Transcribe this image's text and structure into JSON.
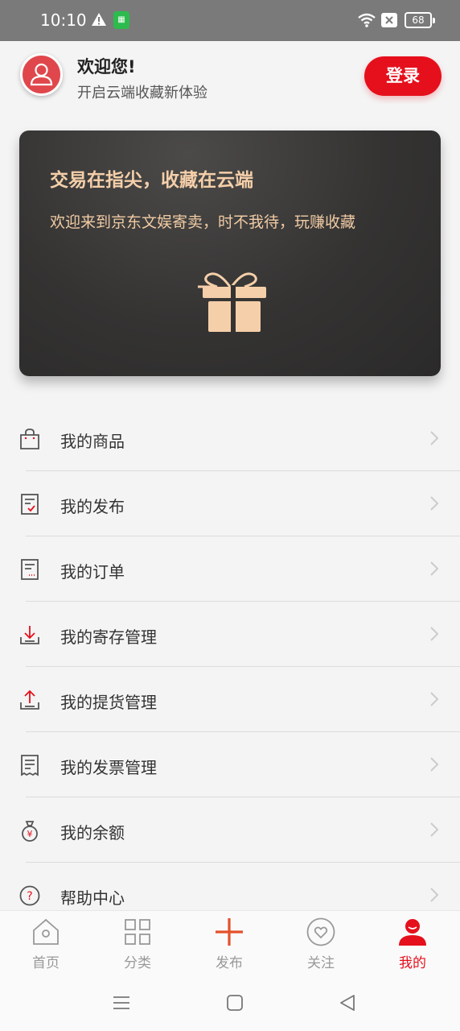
{
  "status_bar": {
    "time": "10:10",
    "battery": "68"
  },
  "header": {
    "greeting": "欢迎您!",
    "sub_greeting": "开启云端收藏新体验",
    "login_label": "登录"
  },
  "promo": {
    "title": "交易在指尖，收藏在云端",
    "subtitle": "欢迎来到京东文娱寄卖，时不我待，玩赚收藏",
    "icon": "gift-icon"
  },
  "menu": {
    "items": [
      {
        "label": "我的商品",
        "icon": "shopping-bag-icon"
      },
      {
        "label": "我的发布",
        "icon": "checklist-icon"
      },
      {
        "label": "我的订单",
        "icon": "order-icon"
      },
      {
        "label": "我的寄存管理",
        "icon": "download-tray-icon"
      },
      {
        "label": "我的提货管理",
        "icon": "upload-tray-icon"
      },
      {
        "label": "我的发票管理",
        "icon": "receipt-icon"
      },
      {
        "label": "我的余额",
        "icon": "money-bag-icon"
      },
      {
        "label": "帮助中心",
        "icon": "help-icon"
      }
    ]
  },
  "tabbar": {
    "tabs": [
      {
        "label": "首页",
        "icon": "home-icon"
      },
      {
        "label": "分类",
        "icon": "grid-icon"
      },
      {
        "label": "发布",
        "icon": "plus-icon"
      },
      {
        "label": "关注",
        "icon": "heart-icon"
      },
      {
        "label": "我的",
        "icon": "user-icon",
        "active": true
      }
    ]
  },
  "colors": {
    "accent": "#e5101c",
    "promo_text": "#f5cfa9",
    "status_bar": "#7a7a7a"
  }
}
